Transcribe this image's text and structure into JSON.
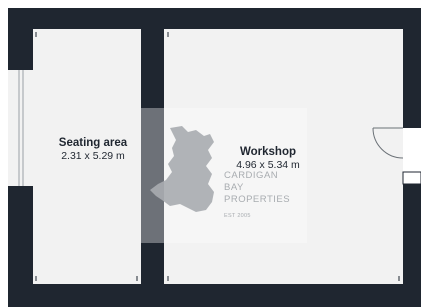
{
  "rooms": [
    {
      "name": "Seating area",
      "dimensions": "2.31 x 5.29 m"
    },
    {
      "name": "Workshop",
      "dimensions": "4.96 x 5.34 m"
    }
  ],
  "watermark": {
    "lines": [
      "CARDIGAN",
      "BAY",
      "PROPERTIES"
    ],
    "established": "EST 2005",
    "emblem": "wales-map-icon"
  },
  "colors": {
    "wall": "#1f2630",
    "floor": "#f2f2f2",
    "watermark": "#a8acb0"
  }
}
